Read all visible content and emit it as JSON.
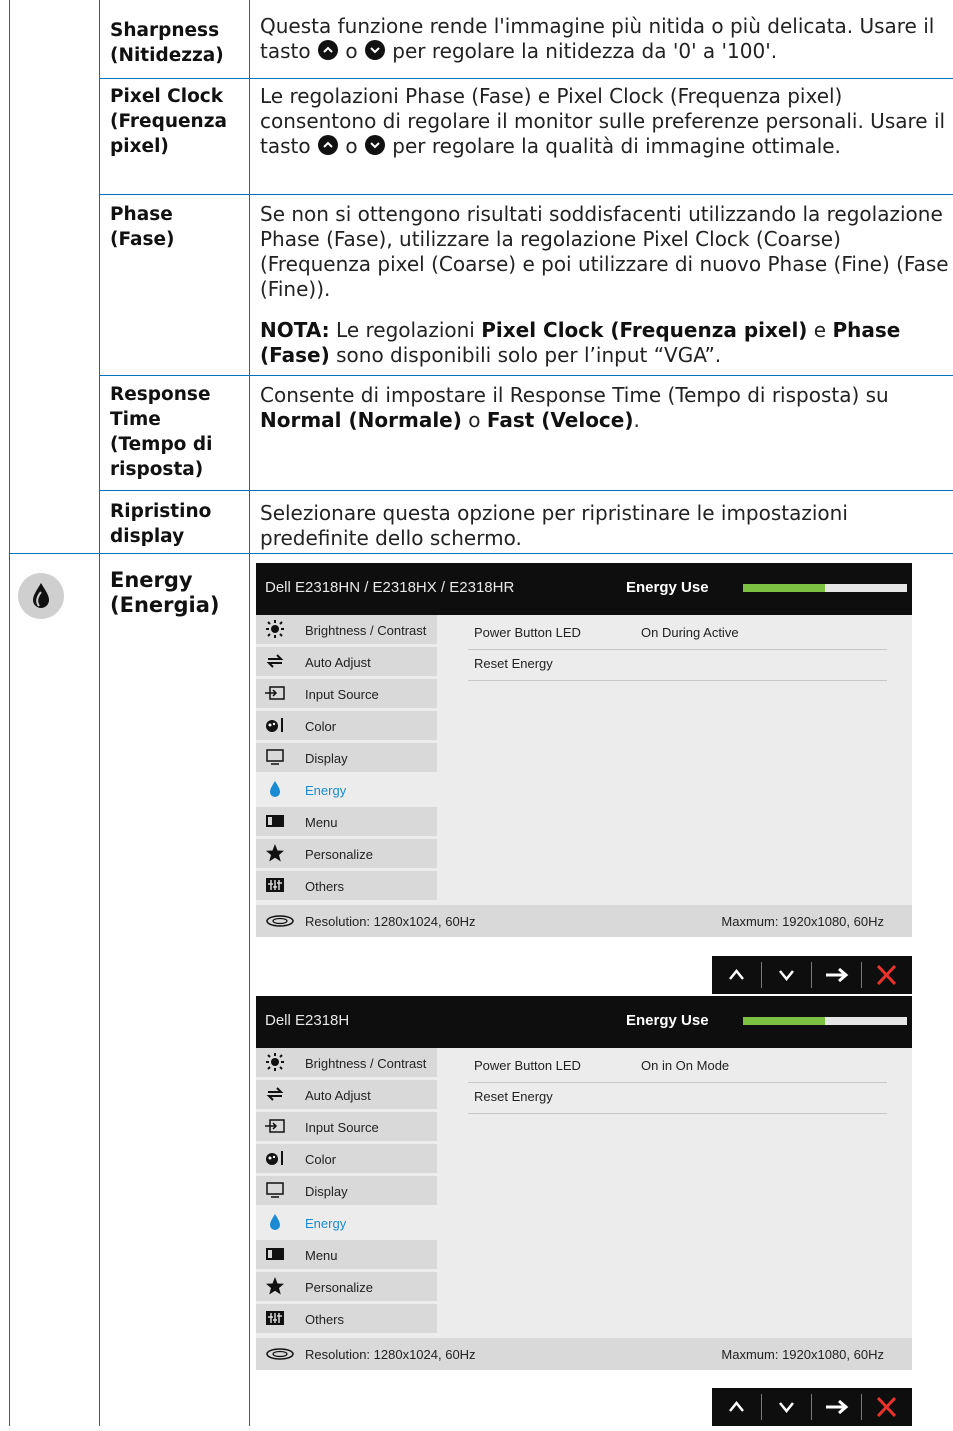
{
  "rows": [
    {
      "label": "Sharpness (Nitidezza)",
      "desc_parts": [
        "Questa funzione rende l'immagine più nitida o più delicata. Usare il tasto ",
        "o",
        "per regolare la nitidezza da '0' a '100'."
      ]
    },
    {
      "label": "Pixel Clock (Frequenza pixel)",
      "desc_parts": [
        "Le regolazioni Phase (Fase) e Pixel Clock (Frequenza pixel) consentono di regolare il monitor sulle preferenze personali. Usare il tasto ",
        "o",
        "per regolare la qualità di immagine ottimale."
      ]
    },
    {
      "label": "Phase (Fase)",
      "desc": "Se non si ottengono risultati soddisfacenti utilizzando la regolazione Phase (Fase), utilizzare la regolazione Pixel Clock (Coarse) (Frequenza pixel (Coarse) e poi utilizzare di nuovo Phase (Fine) (Fase (Fine)).",
      "note": {
        "prefix": "NOTA:",
        "t1": " Le regolazioni ",
        "b1": "Pixel Clock (Frequenza pixel)",
        "t2": " e ",
        "b2": "Phase (Fase)",
        "t3": " sono disponibili solo per l’input “VGA”."
      }
    },
    {
      "label": "Response Time (Tempo di risposta)",
      "desc": "Consente di impostare il Response Time (Tempo di risposta) su ",
      "b1": "Normal (Normale)",
      "t2": " o ",
      "b2": "Fast (Veloce)",
      "t3": "."
    },
    {
      "label": "Ripristino display",
      "desc": "Selezionare questa opzione per ripristinare le impostazioni predefinite dello schermo."
    }
  ],
  "energy": {
    "label": "Energy (Energia)",
    "icon": "leaf-drop-icon"
  },
  "osds": [
    {
      "model": "Dell E2318HN / E2318HX / E2318HR",
      "energy_use_label": "Energy Use",
      "energy_level": 0.5,
      "menu": [
        {
          "label": "Brightness / Contrast",
          "icon": "sun-icon"
        },
        {
          "label": "Auto Adjust",
          "icon": "auto-adjust-icon"
        },
        {
          "label": "Input Source",
          "icon": "input-source-icon"
        },
        {
          "label": "Color",
          "icon": "color-icon"
        },
        {
          "label": "Display",
          "icon": "display-icon"
        },
        {
          "label": "Energy",
          "icon": "energy-icon",
          "active": true
        },
        {
          "label": "Menu",
          "icon": "menu-icon"
        },
        {
          "label": "Personalize",
          "icon": "star-icon"
        },
        {
          "label": "Others",
          "icon": "others-icon"
        }
      ],
      "settings": [
        {
          "name": "Power Button LED",
          "value": "On During Active"
        },
        {
          "name": "Reset Energy",
          "value": ""
        }
      ],
      "resolution": "Resolution: 1280x1024, 60Hz",
      "maximum": "Maxmum: 1920x1080, 60Hz"
    },
    {
      "model": "Dell E2318H",
      "energy_use_label": "Energy Use",
      "energy_level": 0.5,
      "menu": [
        {
          "label": "Brightness / Contrast",
          "icon": "sun-icon"
        },
        {
          "label": "Auto Adjust",
          "icon": "auto-adjust-icon"
        },
        {
          "label": "Input Source",
          "icon": "input-source-icon"
        },
        {
          "label": "Color",
          "icon": "color-icon"
        },
        {
          "label": "Display",
          "icon": "display-icon"
        },
        {
          "label": "Energy",
          "icon": "energy-icon",
          "active": true
        },
        {
          "label": "Menu",
          "icon": "menu-icon"
        },
        {
          "label": "Personalize",
          "icon": "star-icon"
        },
        {
          "label": "Others",
          "icon": "others-icon"
        }
      ],
      "settings": [
        {
          "name": "Power Button LED",
          "value": "On in On Mode"
        },
        {
          "name": "Reset Energy",
          "value": ""
        }
      ],
      "resolution": "Resolution: 1280x1024, 60Hz",
      "maximum": "Maxmum: 1920x1080, 60Hz"
    }
  ],
  "nav_buttons": [
    "up-arrow-icon",
    "down-arrow-icon",
    "right-arrow-icon",
    "close-icon"
  ],
  "colors": {
    "rule": "#0072bb",
    "energy_bar": "#7cc142",
    "active_menu": "#1a8ad4",
    "close": "#e8322a"
  }
}
